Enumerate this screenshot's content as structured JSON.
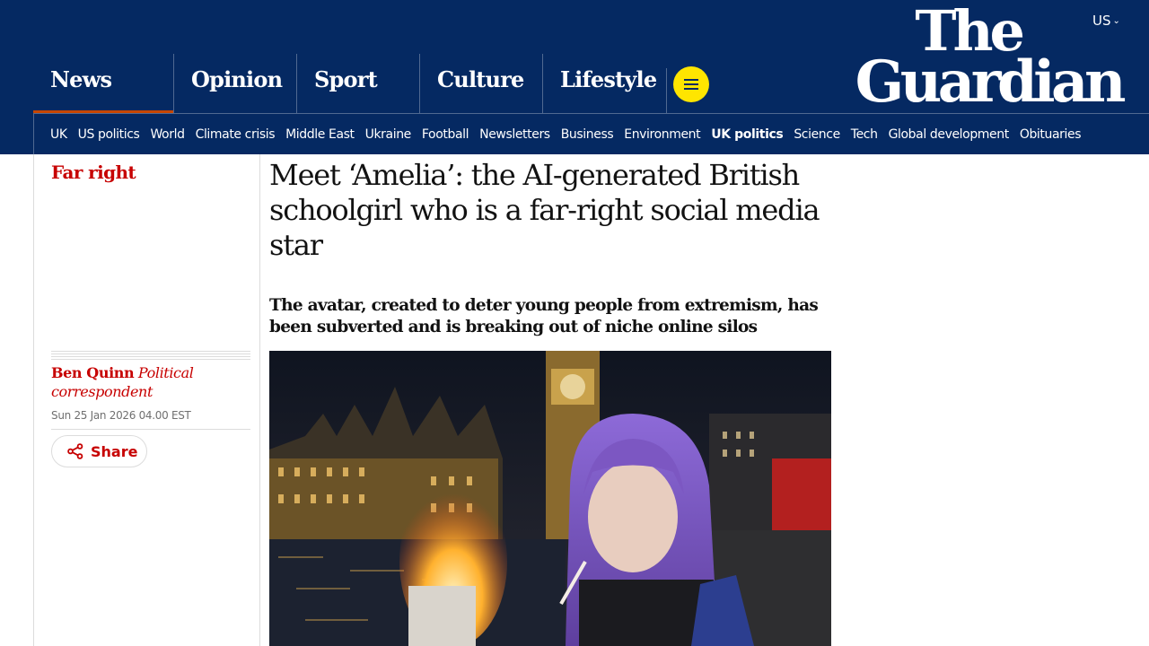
{
  "header": {
    "edition": "US",
    "logo_line1": "The",
    "logo_line2": "Guardian",
    "pillars": [
      {
        "label": "News",
        "active": true
      },
      {
        "label": "Opinion"
      },
      {
        "label": "Sport"
      },
      {
        "label": "Culture"
      },
      {
        "label": "Lifestyle"
      }
    ],
    "subnav": [
      {
        "label": "UK"
      },
      {
        "label": "US politics"
      },
      {
        "label": "World"
      },
      {
        "label": "Climate crisis"
      },
      {
        "label": "Middle East"
      },
      {
        "label": "Ukraine"
      },
      {
        "label": "Football"
      },
      {
        "label": "Newsletters"
      },
      {
        "label": "Business"
      },
      {
        "label": "Environment"
      },
      {
        "label": "UK politics",
        "bold": true
      },
      {
        "label": "Science"
      },
      {
        "label": "Tech"
      },
      {
        "label": "Global development"
      },
      {
        "label": "Obituaries"
      }
    ]
  },
  "article": {
    "kicker": "Far right",
    "headline": "Meet ‘Amelia’: the AI-generated British schoolgirl who is a far-right social media star",
    "standfirst": "The avatar, created to deter young people from extremism, has been subverted and is breaking out of niche online silos",
    "byline_name": "Ben Quinn",
    "byline_role": "Political correspondent",
    "date": "Sun 25 Jan 2026 04.00 EST",
    "share_label": "Share"
  },
  "colors": {
    "brand_blue": "#052962",
    "news_red": "#c70000",
    "menu_yellow": "#ffe500",
    "active_underline": "#c74600"
  }
}
